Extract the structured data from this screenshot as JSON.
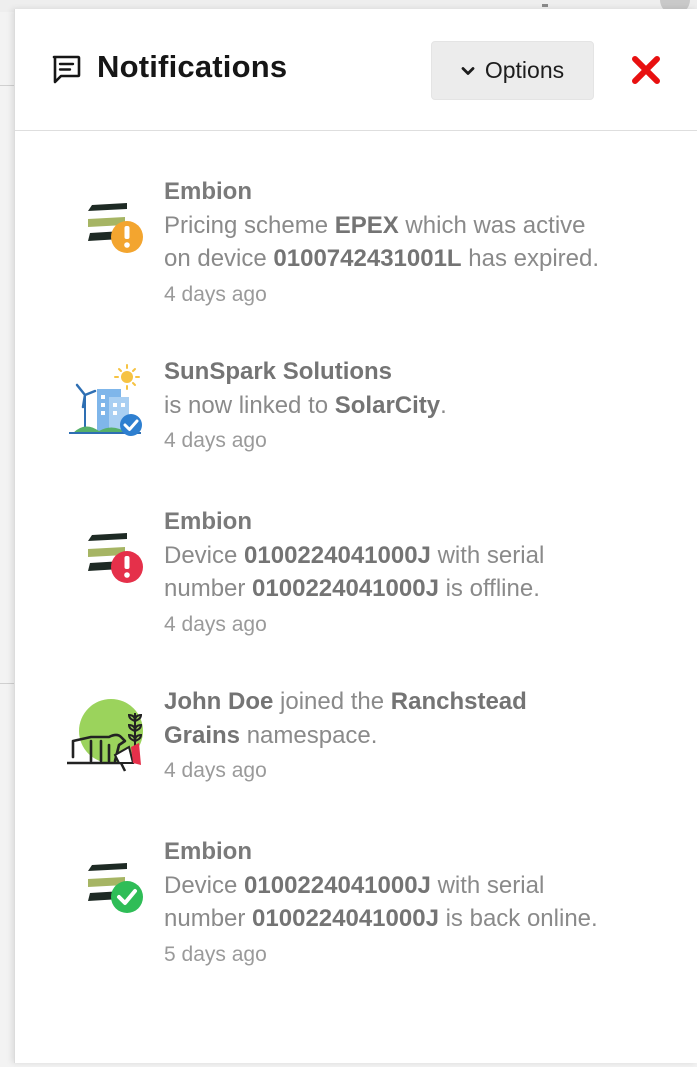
{
  "panel": {
    "title": "Notifications",
    "title_icon": "message-square-icon",
    "options_label": "Options",
    "options_icon": "chevron-down-icon",
    "close_icon": "close-x-icon",
    "close_color": "#e81010"
  },
  "notifications": [
    {
      "icon": "embion-logo-warning-icon",
      "badge_color": "#f3a52f",
      "sender": "Embion",
      "lines": [
        [
          {
            "t": "Pricing scheme "
          },
          {
            "t": "EPEX",
            "b": true
          },
          {
            "t": " which was active"
          }
        ],
        [
          {
            "t": "on device "
          },
          {
            "t": "0100742431001L",
            "b": true
          },
          {
            "t": " has expired."
          }
        ]
      ],
      "time": "4 days ago"
    },
    {
      "icon": "solar-city-linked-icon",
      "badge_color": "#2e7fd0",
      "sender": "",
      "lines": [
        [
          {
            "t": "SunSpark Solutions",
            "b": true
          }
        ],
        [
          {
            "t": "is now linked to "
          },
          {
            "t": "SolarCity",
            "b": true
          },
          {
            "t": "."
          }
        ]
      ],
      "time": "4 days ago"
    },
    {
      "icon": "embion-logo-error-icon",
      "badge_color": "#e5304a",
      "sender": "Embion",
      "lines": [
        [
          {
            "t": "Device "
          },
          {
            "t": "0100224041000J",
            "b": true
          },
          {
            "t": " with serial"
          }
        ],
        [
          {
            "t": "number "
          },
          {
            "t": "0100224041000J",
            "b": true
          },
          {
            "t": " is offline."
          }
        ]
      ],
      "time": "4 days ago"
    },
    {
      "icon": "ranch-join-megaphone-icon",
      "badge_color": "#e5304a",
      "sender": "",
      "lines": [
        [
          {
            "t": "John Doe",
            "b": true
          },
          {
            "t": " joined the "
          },
          {
            "t": "Ranchstead",
            "b": true
          }
        ],
        [
          {
            "t": "Grains",
            "b": true
          },
          {
            "t": " namespace."
          }
        ]
      ],
      "time": "4 days ago"
    },
    {
      "icon": "embion-logo-success-icon",
      "badge_color": "#2fbd57",
      "sender": "Embion",
      "lines": [
        [
          {
            "t": "Device "
          },
          {
            "t": "0100224041000J",
            "b": true
          },
          {
            "t": " with serial"
          }
        ],
        [
          {
            "t": "number "
          },
          {
            "t": "0100224041000J",
            "b": true
          },
          {
            "t": " is back online."
          }
        ]
      ],
      "time": "5 days ago"
    }
  ]
}
